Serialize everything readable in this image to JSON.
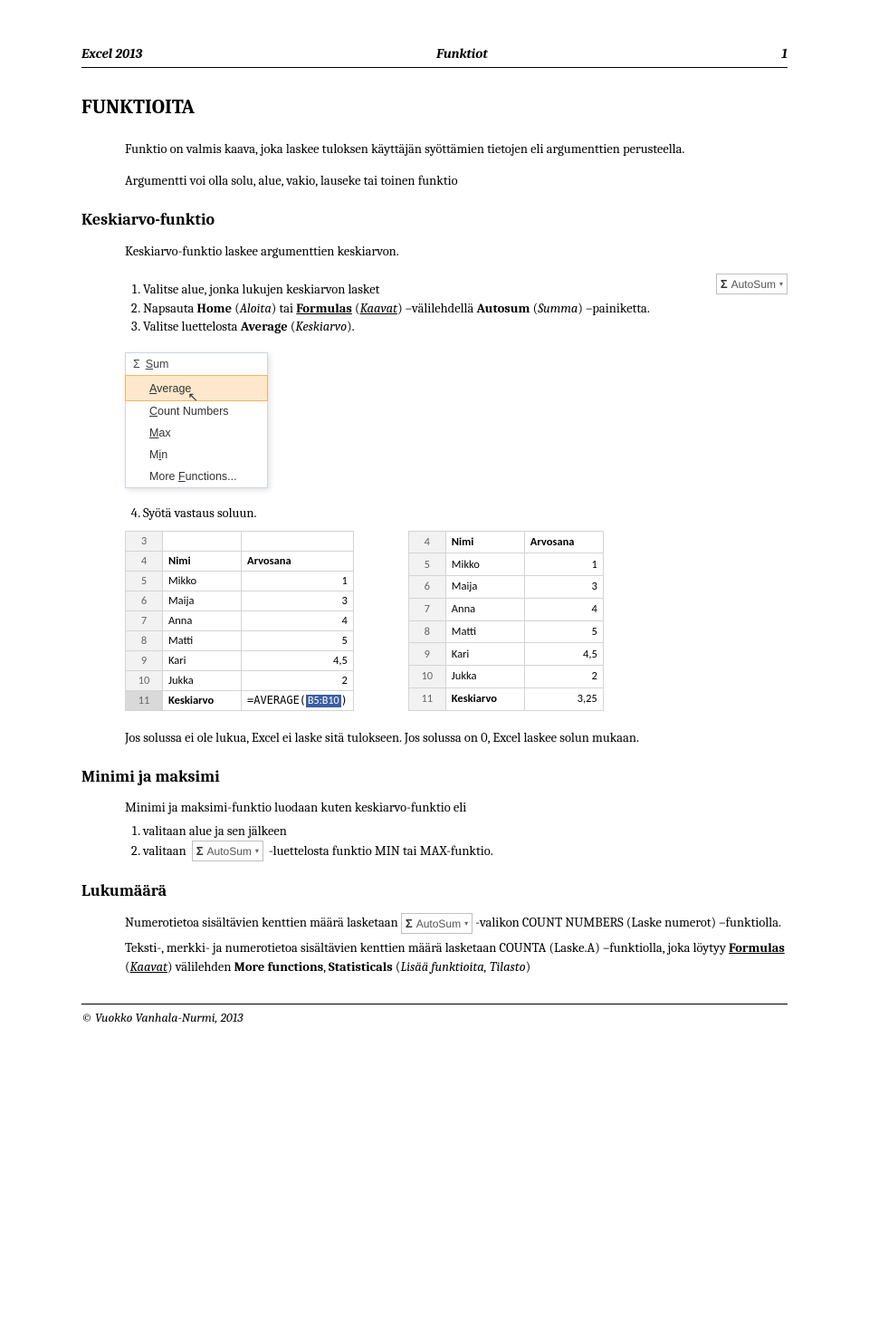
{
  "header": {
    "left": "Excel 2013",
    "center": "Funktiot",
    "right": "1"
  },
  "h1": "FUNKTIOITA",
  "intro1": "Funktio on valmis kaava, joka laskee tuloksen käyttäjän syöttämien tietojen eli argumenttien perusteella.",
  "intro2": "Argumentti voi olla solu, alue, vakio, lauseke tai toinen funktio",
  "sec_keskiarvo": "Keskiarvo-funktio",
  "kesk_p": "Keskiarvo-funktio laskee argumenttien keskiarvon.",
  "steps_k": [
    "Valitse alue, jonka lukujen keskiarvon lasket",
    "Napsauta Home (Aloita) tai Formulas (Kaavat) –välilehdellä  Autosum (Summa) –painiketta.",
    "Valitse luettelosta Average (Keskiarvo)."
  ],
  "step4": "Syötä vastaus soluun.",
  "autosum_label": "AutoSum",
  "menu": {
    "head": "Sum",
    "items": [
      "Average",
      "Count Numbers",
      "Max",
      "Min",
      "More Functions..."
    ],
    "underlineIdx": [
      0,
      0,
      2,
      1,
      6
    ]
  },
  "table_a": {
    "cols": [
      "",
      ""
    ],
    "rows": [
      [
        "3",
        "",
        ""
      ],
      [
        "4",
        "Nimi",
        "Arvosana"
      ],
      [
        "5",
        "Mikko",
        "1"
      ],
      [
        "6",
        "Maija",
        "3"
      ],
      [
        "7",
        "Anna",
        "4"
      ],
      [
        "8",
        "Matti",
        "5"
      ],
      [
        "9",
        "Kari",
        "4,5"
      ],
      [
        "10",
        "Jukka",
        "2"
      ],
      [
        "11",
        "Keskiarvo",
        "=AVERAGE(B5:B10)"
      ]
    ]
  },
  "table_b": {
    "rows": [
      [
        "4",
        "Nimi",
        "Arvosana"
      ],
      [
        "5",
        "Mikko",
        "1"
      ],
      [
        "6",
        "Maija",
        "3"
      ],
      [
        "7",
        "Anna",
        "4"
      ],
      [
        "8",
        "Matti",
        "5"
      ],
      [
        "9",
        "Kari",
        "4,5"
      ],
      [
        "10",
        "Jukka",
        "2"
      ],
      [
        "11",
        "Keskiarvo",
        "3,25"
      ]
    ]
  },
  "note_solu": "Jos solussa ei ole lukua, Excel ei laske sitä tulokseen. Jos solussa on 0, Excel laskee solun mukaan.",
  "sec_minmax": "Minimi ja maksimi",
  "minmax_p": "Minimi ja maksimi-funktio luodaan  kuten keskiarvo-funktio eli",
  "mm_step1": "valitaan alue ja sen jälkeen",
  "mm_step2a": "valitaan",
  "mm_step2b": "-luettelosta funktio MIN tai MAX-funktio.",
  "sec_luku": "Lukumäärä",
  "luku_p1a": "Numerotietoa sisältävien kenttien määrä lasketaan",
  "luku_p1b": "-valikon COUNT NUMBERS (Laske numerot) –funktiolla.",
  "luku_p2": "Teksti-, merkki- ja numerotietoa sisältävien kenttien määrä lasketaan COUNTA (Laske.A) –funktiolla, joka löytyy Formulas (Kaavat) välilehden More functions, Statisticals (Lisää funktioita, Tilasto)",
  "footer": "© Vuokko Vanhala-Nurmi, 2013"
}
